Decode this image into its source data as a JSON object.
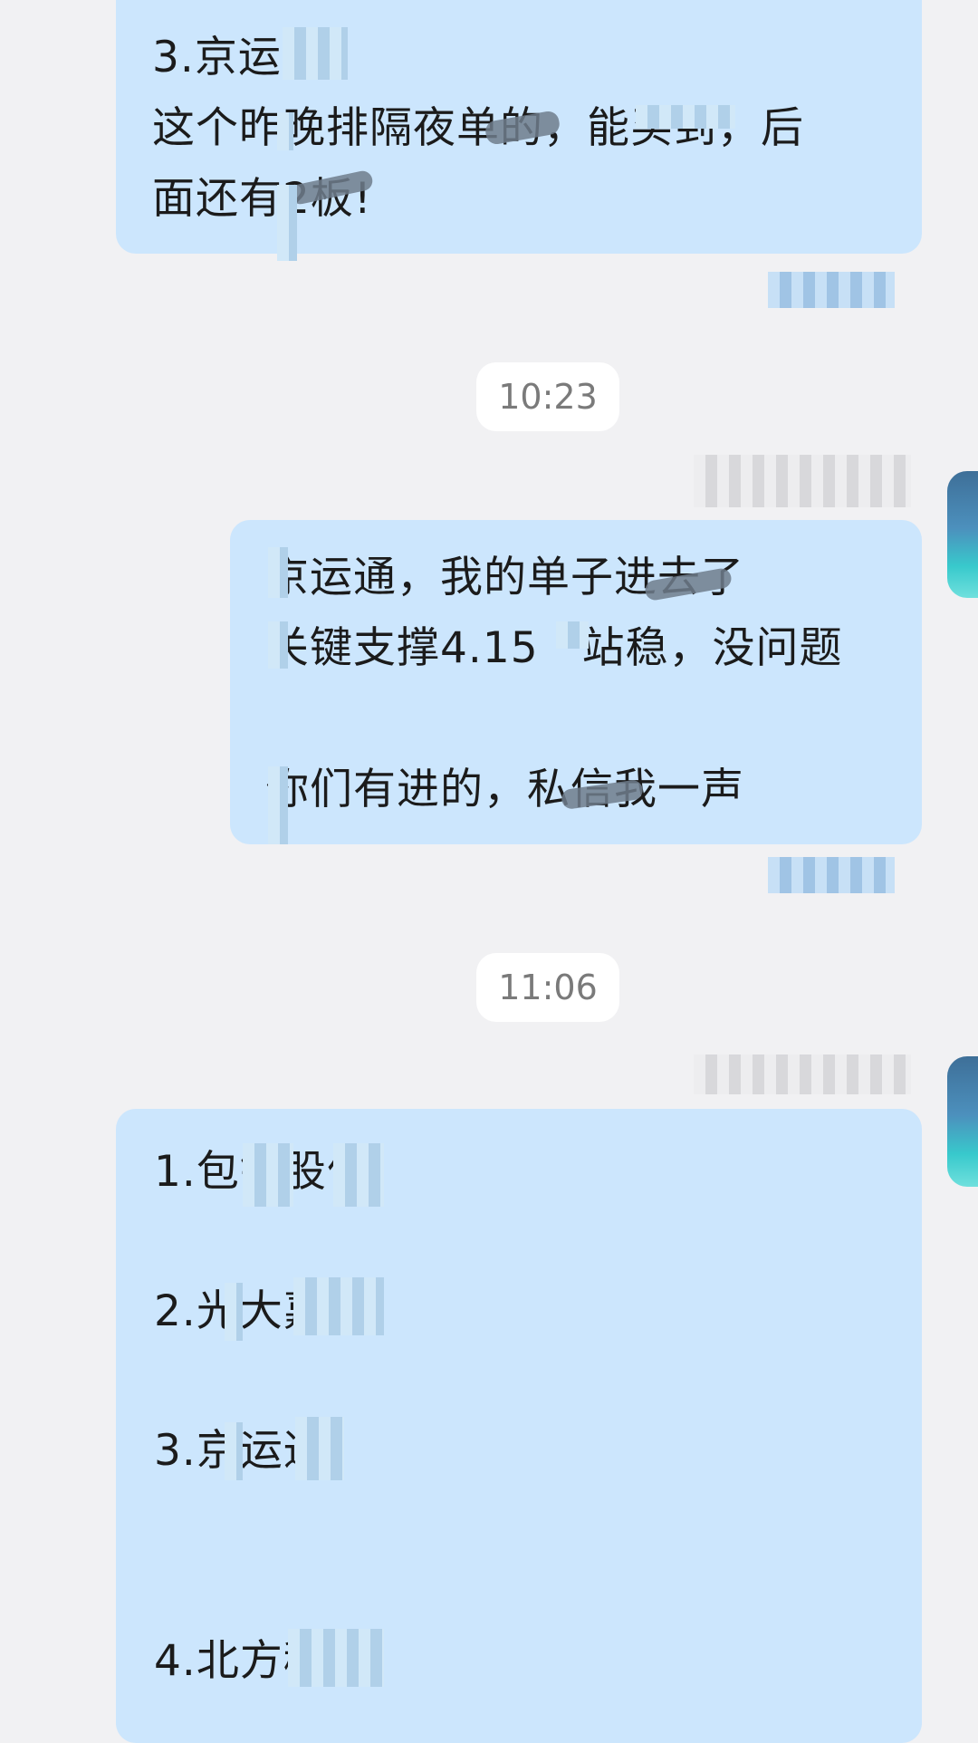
{
  "messages": [
    {
      "id": "msg1",
      "lines": [
        "3.京运通",
        "这个昨晚排隔夜单的，能买到，后",
        "面还有2板!"
      ]
    },
    {
      "id": "msg2",
      "lines": [
        "京运通，我的单子进去了",
        "关键支撑4.15   站稳，没问题",
        "",
        "你们有进的，私信我一声"
      ]
    },
    {
      "id": "msg3",
      "lines": [
        "1.包钢股份",
        "2.光大嘉宝",
        "3.京运通",
        "4.北方稀土"
      ]
    }
  ],
  "timestamps": {
    "t1": "10:23",
    "t2": "11:06"
  },
  "colors": {
    "background": "#f1f1f3",
    "bubble": "#cce6fd",
    "timestamp_pill": "#ffffff",
    "timestamp_text": "#7a7a7a"
  },
  "icons": {
    "avatar": "avatar-image"
  }
}
